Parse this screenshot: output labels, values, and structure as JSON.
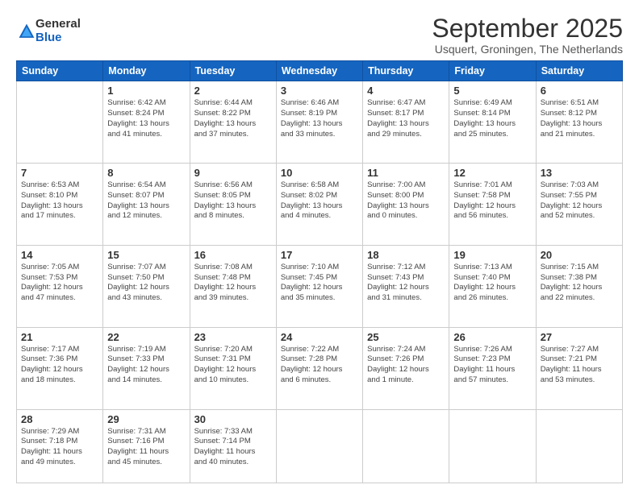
{
  "header": {
    "logo": {
      "line1": "General",
      "line2": "Blue"
    },
    "title": "September 2025",
    "location": "Usquert, Groningen, The Netherlands"
  },
  "weekdays": [
    "Sunday",
    "Monday",
    "Tuesday",
    "Wednesday",
    "Thursday",
    "Friday",
    "Saturday"
  ],
  "weeks": [
    [
      {
        "day": "",
        "info": ""
      },
      {
        "day": "1",
        "info": "Sunrise: 6:42 AM\nSunset: 8:24 PM\nDaylight: 13 hours\nand 41 minutes."
      },
      {
        "day": "2",
        "info": "Sunrise: 6:44 AM\nSunset: 8:22 PM\nDaylight: 13 hours\nand 37 minutes."
      },
      {
        "day": "3",
        "info": "Sunrise: 6:46 AM\nSunset: 8:19 PM\nDaylight: 13 hours\nand 33 minutes."
      },
      {
        "day": "4",
        "info": "Sunrise: 6:47 AM\nSunset: 8:17 PM\nDaylight: 13 hours\nand 29 minutes."
      },
      {
        "day": "5",
        "info": "Sunrise: 6:49 AM\nSunset: 8:14 PM\nDaylight: 13 hours\nand 25 minutes."
      },
      {
        "day": "6",
        "info": "Sunrise: 6:51 AM\nSunset: 8:12 PM\nDaylight: 13 hours\nand 21 minutes."
      }
    ],
    [
      {
        "day": "7",
        "info": "Sunrise: 6:53 AM\nSunset: 8:10 PM\nDaylight: 13 hours\nand 17 minutes."
      },
      {
        "day": "8",
        "info": "Sunrise: 6:54 AM\nSunset: 8:07 PM\nDaylight: 13 hours\nand 12 minutes."
      },
      {
        "day": "9",
        "info": "Sunrise: 6:56 AM\nSunset: 8:05 PM\nDaylight: 13 hours\nand 8 minutes."
      },
      {
        "day": "10",
        "info": "Sunrise: 6:58 AM\nSunset: 8:02 PM\nDaylight: 13 hours\nand 4 minutes."
      },
      {
        "day": "11",
        "info": "Sunrise: 7:00 AM\nSunset: 8:00 PM\nDaylight: 13 hours\nand 0 minutes."
      },
      {
        "day": "12",
        "info": "Sunrise: 7:01 AM\nSunset: 7:58 PM\nDaylight: 12 hours\nand 56 minutes."
      },
      {
        "day": "13",
        "info": "Sunrise: 7:03 AM\nSunset: 7:55 PM\nDaylight: 12 hours\nand 52 minutes."
      }
    ],
    [
      {
        "day": "14",
        "info": "Sunrise: 7:05 AM\nSunset: 7:53 PM\nDaylight: 12 hours\nand 47 minutes."
      },
      {
        "day": "15",
        "info": "Sunrise: 7:07 AM\nSunset: 7:50 PM\nDaylight: 12 hours\nand 43 minutes."
      },
      {
        "day": "16",
        "info": "Sunrise: 7:08 AM\nSunset: 7:48 PM\nDaylight: 12 hours\nand 39 minutes."
      },
      {
        "day": "17",
        "info": "Sunrise: 7:10 AM\nSunset: 7:45 PM\nDaylight: 12 hours\nand 35 minutes."
      },
      {
        "day": "18",
        "info": "Sunrise: 7:12 AM\nSunset: 7:43 PM\nDaylight: 12 hours\nand 31 minutes."
      },
      {
        "day": "19",
        "info": "Sunrise: 7:13 AM\nSunset: 7:40 PM\nDaylight: 12 hours\nand 26 minutes."
      },
      {
        "day": "20",
        "info": "Sunrise: 7:15 AM\nSunset: 7:38 PM\nDaylight: 12 hours\nand 22 minutes."
      }
    ],
    [
      {
        "day": "21",
        "info": "Sunrise: 7:17 AM\nSunset: 7:36 PM\nDaylight: 12 hours\nand 18 minutes."
      },
      {
        "day": "22",
        "info": "Sunrise: 7:19 AM\nSunset: 7:33 PM\nDaylight: 12 hours\nand 14 minutes."
      },
      {
        "day": "23",
        "info": "Sunrise: 7:20 AM\nSunset: 7:31 PM\nDaylight: 12 hours\nand 10 minutes."
      },
      {
        "day": "24",
        "info": "Sunrise: 7:22 AM\nSunset: 7:28 PM\nDaylight: 12 hours\nand 6 minutes."
      },
      {
        "day": "25",
        "info": "Sunrise: 7:24 AM\nSunset: 7:26 PM\nDaylight: 12 hours\nand 1 minute."
      },
      {
        "day": "26",
        "info": "Sunrise: 7:26 AM\nSunset: 7:23 PM\nDaylight: 11 hours\nand 57 minutes."
      },
      {
        "day": "27",
        "info": "Sunrise: 7:27 AM\nSunset: 7:21 PM\nDaylight: 11 hours\nand 53 minutes."
      }
    ],
    [
      {
        "day": "28",
        "info": "Sunrise: 7:29 AM\nSunset: 7:18 PM\nDaylight: 11 hours\nand 49 minutes."
      },
      {
        "day": "29",
        "info": "Sunrise: 7:31 AM\nSunset: 7:16 PM\nDaylight: 11 hours\nand 45 minutes."
      },
      {
        "day": "30",
        "info": "Sunrise: 7:33 AM\nSunset: 7:14 PM\nDaylight: 11 hours\nand 40 minutes."
      },
      {
        "day": "",
        "info": ""
      },
      {
        "day": "",
        "info": ""
      },
      {
        "day": "",
        "info": ""
      },
      {
        "day": "",
        "info": ""
      }
    ]
  ]
}
